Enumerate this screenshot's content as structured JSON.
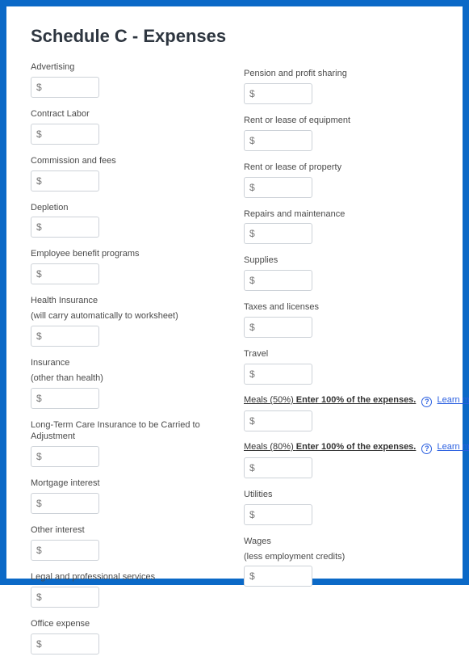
{
  "title": "Schedule C - Expenses",
  "placeholder": "$",
  "learn_more": "Learn more",
  "left": [
    {
      "label": "Advertising"
    },
    {
      "label": "Contract Labor"
    },
    {
      "label": "Commission and fees"
    },
    {
      "label": "Depletion"
    },
    {
      "label": "Employee benefit programs"
    },
    {
      "label": "Health Insurance",
      "sublabel": "(will carry automatically to worksheet)"
    },
    {
      "label": "Insurance",
      "sublabel": "(other than health)"
    },
    {
      "label": "Long-Term Care Insurance to be Carried to Adjustment"
    },
    {
      "label": "Mortgage interest"
    },
    {
      "label": "Other interest"
    },
    {
      "label": "Legal and professional services"
    },
    {
      "label": "Office expense"
    }
  ],
  "right": [
    {
      "label": "Pension and profit sharing"
    },
    {
      "label": "Rent or lease of equipment"
    },
    {
      "label": "Rent or lease of property"
    },
    {
      "label": "Repairs and maintenance"
    },
    {
      "label": "Supplies"
    },
    {
      "label": "Taxes and licenses"
    },
    {
      "label": "Travel"
    }
  ],
  "meals": [
    {
      "prefix": "Meals (50%) ",
      "bold": "Enter 100% of the expenses."
    },
    {
      "prefix": "Meals (80%) ",
      "bold": "Enter 100% of the expenses."
    }
  ],
  "right_tail": [
    {
      "label": "Utilities"
    },
    {
      "label": "Wages",
      "sublabel": "(less employment credits)"
    }
  ]
}
